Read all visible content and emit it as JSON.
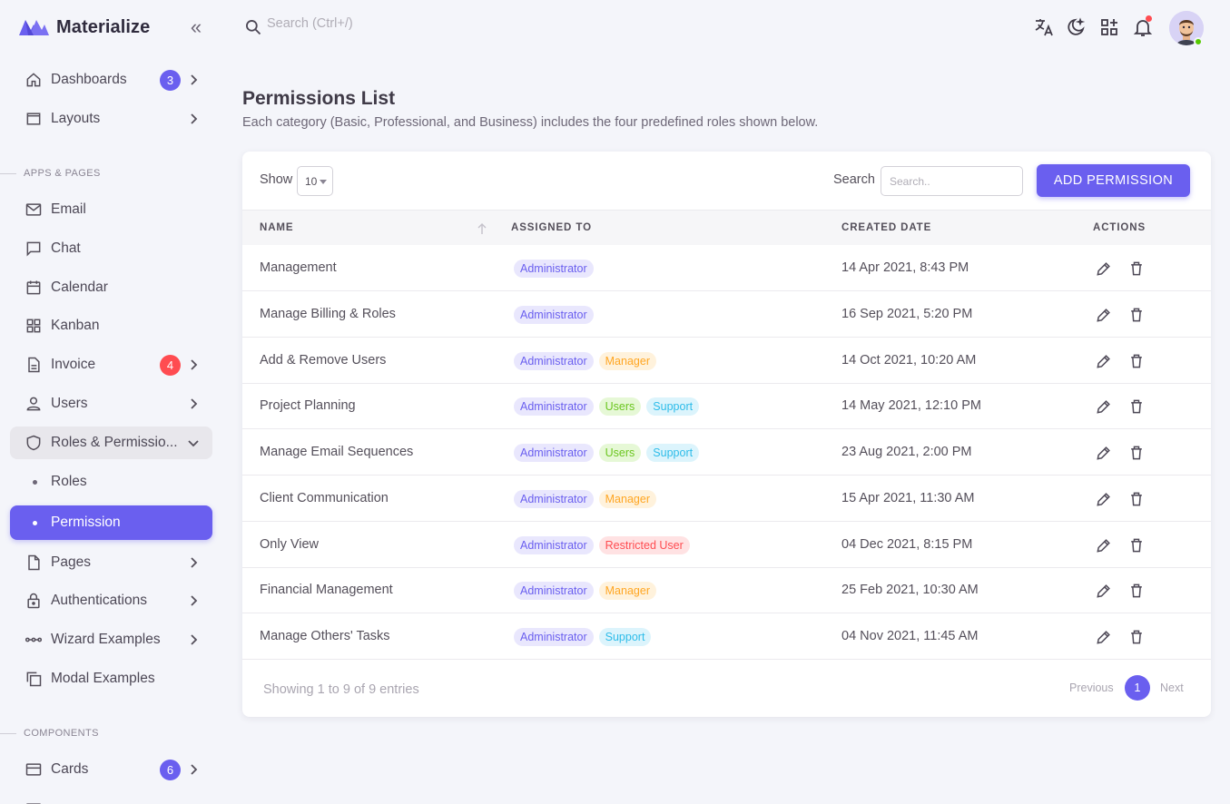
{
  "app": {
    "brand_name": "Materialize",
    "search_placeholder": "Search (Ctrl+/)",
    "brand_color": "#6a5fef"
  },
  "sidebar": {
    "items": [
      {
        "label": "Dashboards",
        "icon": "home-icon",
        "badge": "3",
        "badge_color": "#6a5fef"
      },
      {
        "label": "Layouts",
        "icon": "layout-icon"
      },
      {
        "label": "Email",
        "icon": "mail-icon"
      },
      {
        "label": "Chat",
        "icon": "chat-icon"
      },
      {
        "label": "Calendar",
        "icon": "calendar-icon"
      },
      {
        "label": "Kanban",
        "icon": "grid-icon"
      },
      {
        "label": "Invoice",
        "icon": "file-icon",
        "badge": "4",
        "badge_color": "#ff4c51"
      },
      {
        "label": "Users",
        "icon": "user-icon"
      },
      {
        "label": "Roles & Permissio...",
        "icon": "shield-icon"
      },
      {
        "label": "Roles"
      },
      {
        "label": "Permission"
      },
      {
        "label": "Pages",
        "icon": "page-icon"
      },
      {
        "label": "Authentications",
        "icon": "lock-icon"
      },
      {
        "label": "Wizard Examples",
        "icon": "wizard-icon"
      },
      {
        "label": "Modal Examples",
        "icon": "copy-icon"
      },
      {
        "label": "Cards",
        "icon": "card-icon",
        "badge": "6",
        "badge_color": "#6a5fef"
      }
    ],
    "sections": {
      "apps_pages": "APPS & PAGES",
      "components": "COMPONENTS"
    }
  },
  "header": {
    "title": "Permissions List",
    "subtitle": "Each category (Basic, Professional, and Business) includes the four predefined roles shown below."
  },
  "toolbar": {
    "show_label": "Show",
    "page_size": "10",
    "search_label": "Search",
    "search_placeholder": "Search..",
    "add_button": "ADD PERMISSION"
  },
  "table": {
    "columns": [
      "NAME",
      "ASSIGNED TO",
      "CREATED DATE",
      "ACTIONS"
    ],
    "rows": [
      {
        "name": "Management",
        "assigned": [
          {
            "label": "Administrator",
            "kind": "admin"
          }
        ],
        "date": "14 Apr 2021, 8:43 PM"
      },
      {
        "name": "Manage Billing & Roles",
        "assigned": [
          {
            "label": "Administrator",
            "kind": "admin"
          }
        ],
        "date": "16 Sep 2021, 5:20 PM"
      },
      {
        "name": "Add & Remove Users",
        "assigned": [
          {
            "label": "Administrator",
            "kind": "admin"
          },
          {
            "label": "Manager",
            "kind": "manager"
          }
        ],
        "date": "14 Oct 2021, 10:20 AM"
      },
      {
        "name": "Project Planning",
        "assigned": [
          {
            "label": "Administrator",
            "kind": "admin"
          },
          {
            "label": "Users",
            "kind": "users"
          },
          {
            "label": "Support",
            "kind": "support"
          }
        ],
        "date": "14 May 2021, 12:10 PM"
      },
      {
        "name": "Manage Email Sequences",
        "assigned": [
          {
            "label": "Administrator",
            "kind": "admin"
          },
          {
            "label": "Users",
            "kind": "users"
          },
          {
            "label": "Support",
            "kind": "support"
          }
        ],
        "date": "23 Aug 2021, 2:00 PM"
      },
      {
        "name": "Client Communication",
        "assigned": [
          {
            "label": "Administrator",
            "kind": "admin"
          },
          {
            "label": "Manager",
            "kind": "manager"
          }
        ],
        "date": "15 Apr 2021, 11:30 AM"
      },
      {
        "name": "Only View",
        "assigned": [
          {
            "label": "Administrator",
            "kind": "admin"
          },
          {
            "label": "Restricted User",
            "kind": "restricted"
          }
        ],
        "date": "04 Dec 2021, 8:15 PM"
      },
      {
        "name": "Financial Management",
        "assigned": [
          {
            "label": "Administrator",
            "kind": "admin"
          },
          {
            "label": "Manager",
            "kind": "manager"
          }
        ],
        "date": "25 Feb 2021, 10:30 AM"
      },
      {
        "name": "Manage Others' Tasks",
        "assigned": [
          {
            "label": "Administrator",
            "kind": "admin"
          },
          {
            "label": "Support",
            "kind": "support"
          }
        ],
        "date": "04 Nov 2021, 11:45 AM"
      }
    ]
  },
  "footer": {
    "info": "Showing 1 to 9 of 9 entries",
    "previous": "Previous",
    "current_page": "1",
    "next": "Next"
  }
}
